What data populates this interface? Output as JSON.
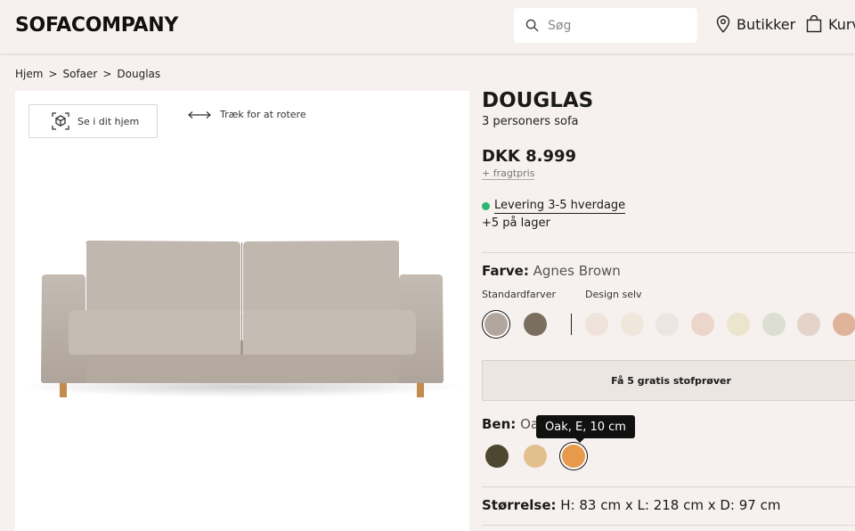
{
  "header": {
    "logo": "SOFACOMPANY",
    "search_placeholder": "Søg",
    "stores_label": "Butikker",
    "cart_label": "Kurv"
  },
  "breadcrumb": [
    "Hjem",
    ">",
    "Sofaer",
    ">",
    "Douglas"
  ],
  "gallery": {
    "ar_button_label": "Se i dit hjem",
    "rotate_hint": "Træk for at rotere"
  },
  "product": {
    "name": "DOUGLAS",
    "subtitle": "3 personers sofa",
    "price": "DKK 8.999",
    "freight": "+ fragtpris",
    "delivery": "Levering 3-5 hverdage",
    "stock": "+5 på lager",
    "delivery_color": "#2bb673"
  },
  "color": {
    "label": "Farve:",
    "value": "Agnes Brown",
    "standard_label": "Standardfarver",
    "design_label": "Design selv",
    "standard_swatches": [
      "#b3a69f",
      "#7a6f5f"
    ],
    "design_swatches": [
      "#efe3dc",
      "#efe7dc",
      "#ebe6e1",
      "#ecd6cc",
      "#ebe5cd",
      "#dcddd3",
      "#e3d3c9",
      "#dfb39a"
    ]
  },
  "samples_button": "Få 5 gratis stofprøver",
  "legs": {
    "label": "Ben:",
    "value": "Oak",
    "tooltip": "Oak, E, 10 cm",
    "swatches": [
      "#4d4630",
      "#e2c08e",
      "#e79a4c"
    ]
  },
  "size": {
    "label": "Størrelse:",
    "value": "H: 83 cm x L: 218 cm x D: 97 cm"
  }
}
